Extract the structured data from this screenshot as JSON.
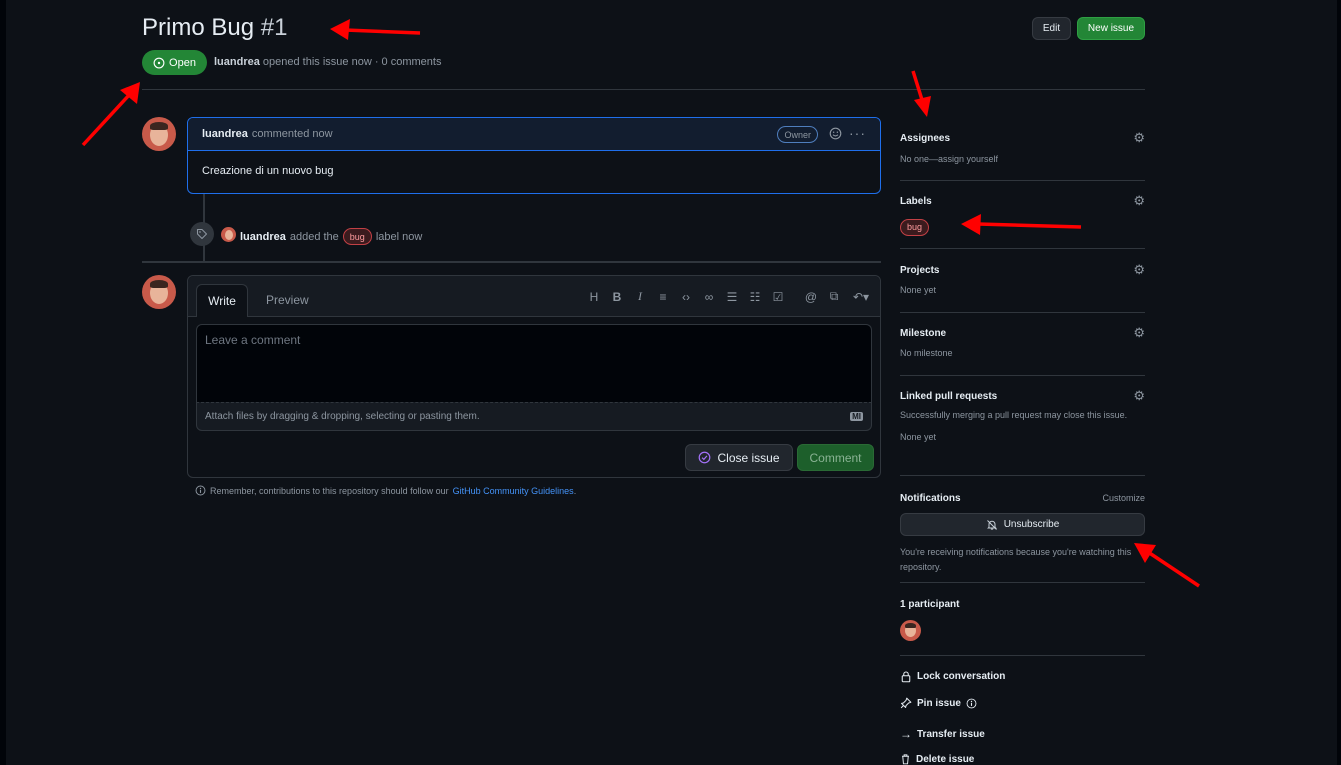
{
  "issue": {
    "title": "Primo Bug",
    "number": "#1",
    "state": "Open",
    "author": "luandrea",
    "meta": "opened this issue now · 0 comments"
  },
  "header_buttons": {
    "edit": "Edit",
    "new_issue": "New issue"
  },
  "comment": {
    "author": "luandrea",
    "time": "commented now",
    "role": "Owner",
    "body": "Creazione di un nuovo bug"
  },
  "event": {
    "actor": "luandrea",
    "text_before": "added the",
    "label": "bug",
    "text_after": "label now"
  },
  "composer": {
    "tab_write": "Write",
    "tab_preview": "Preview",
    "placeholder": "Leave a comment",
    "attach_hint": "Attach files by dragging & dropping, selecting or pasting them.",
    "md_badge": "MI",
    "close_button": "Close issue",
    "comment_button": "Comment",
    "toolbar": [
      "H",
      "B",
      "I"
    ]
  },
  "guidelines": {
    "text": "Remember, contributions to this repository should follow our",
    "link": "GitHub Community Guidelines",
    "end": "."
  },
  "sidebar": {
    "assignees": {
      "title": "Assignees",
      "value": "No one—assign yourself"
    },
    "labels": {
      "title": "Labels",
      "value": "bug"
    },
    "projects": {
      "title": "Projects",
      "value": "None yet"
    },
    "milestone": {
      "title": "Milestone",
      "value": "No milestone"
    },
    "linked_prs": {
      "title": "Linked pull requests",
      "description": "Successfully merging a pull request may close this issue.",
      "value": "None yet"
    },
    "notifications": {
      "title": "Notifications",
      "customize": "Customize",
      "button": "Unsubscribe",
      "note": "You're receiving notifications because you're watching this repository."
    },
    "participants": {
      "title": "1 participant"
    },
    "actions": {
      "lock": "Lock conversation",
      "pin": "Pin issue",
      "transfer": "Transfer issue",
      "delete": "Delete issue"
    }
  },
  "colors": {
    "background": "#0d1117",
    "open_green": "#238636",
    "accent_blue": "#1f6feb",
    "annotation_red": "#ff0000"
  }
}
